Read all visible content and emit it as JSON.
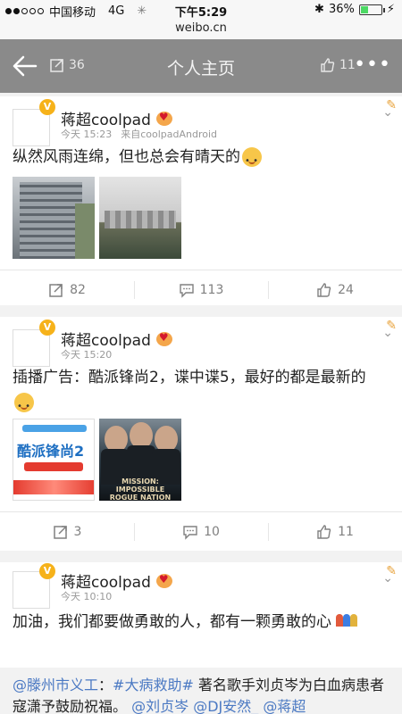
{
  "status_bar": {
    "carrier": "中国移动",
    "network": "4G",
    "time": "下午5:29",
    "battery": "36%",
    "battery_level": 0.36
  },
  "browser": {
    "url": "weibo.cn"
  },
  "nav": {
    "title": "个人主页",
    "repost_count": "36",
    "like_count": "11"
  },
  "posts": [
    {
      "author": "蒋超coolpad",
      "time": "今天 15:23",
      "source": "来自coolpadAndroid",
      "text": "纵然风雨连绵，但也总会有晴天的",
      "actions": {
        "repost": "82",
        "comment": "113",
        "like": "24"
      }
    },
    {
      "author": "蒋超coolpad",
      "time": "今天 15:20",
      "text": "插播广告：酷派锋尚2，谍中谍5，最好的都是最新的",
      "ad_image": {
        "title": "酷派锋尚2",
        "movie_title": "MISSION: IMPOSSIBLE ROGUE NATION"
      },
      "actions": {
        "repost": "3",
        "comment": "10",
        "like": "11"
      }
    },
    {
      "author": "蒋超coolpad",
      "time": "今天 10:10",
      "text": "加油，我们都要做勇敢的人，都有一颗勇敢的心",
      "repost": {
        "mention1": "@滕州市义工",
        "colon": "：",
        "topic": "#大病救助#",
        "text": " 著名歌手刘贞岑为白血病患者寇潇予鼓励祝福。",
        "mention2": "@刘贞岑",
        "mention3": "@DJ安然_",
        "mention4": "@蒋超"
      }
    }
  ],
  "colors": {
    "accent": "#4b79c3",
    "vip": "#f6b21a"
  }
}
